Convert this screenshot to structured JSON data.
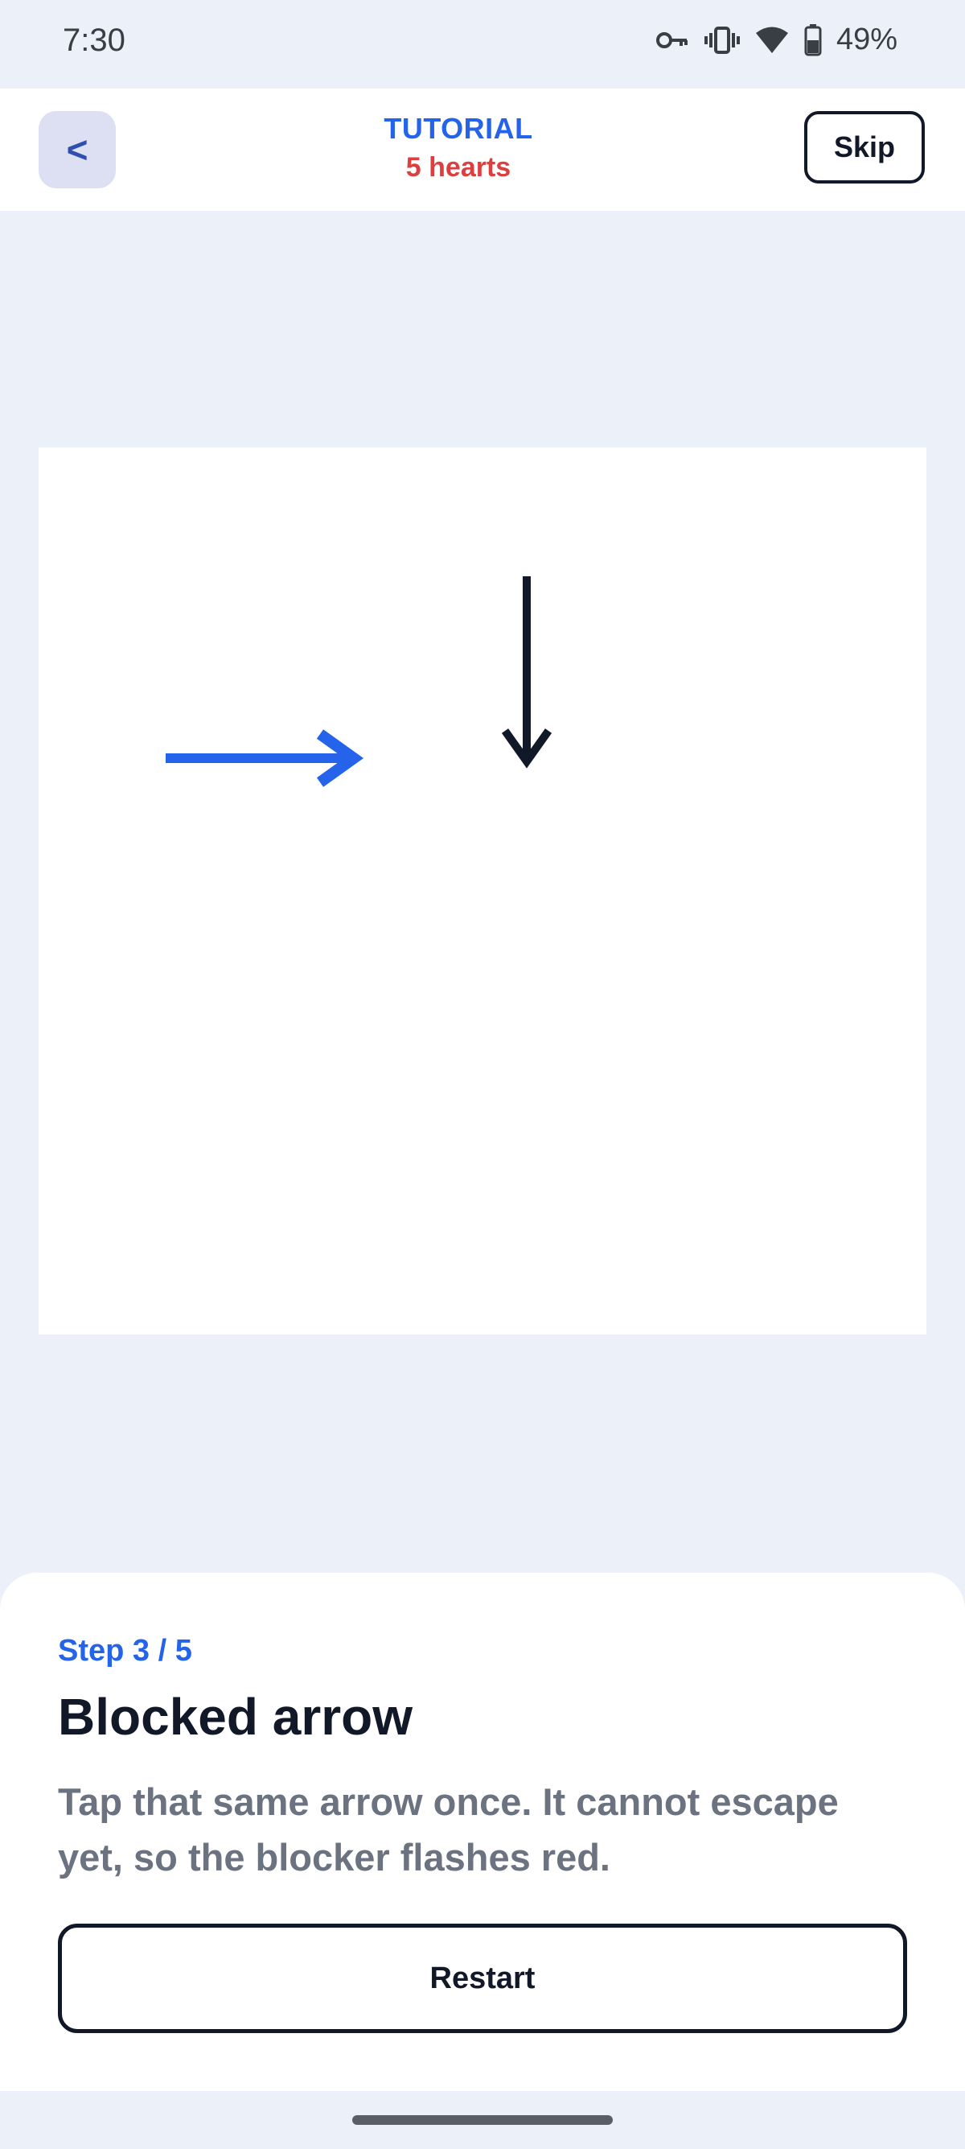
{
  "status_bar": {
    "time": "7:30",
    "battery": "49%",
    "icons": [
      "vpn-key-icon",
      "vibrate-icon",
      "wifi-icon",
      "battery-icon"
    ]
  },
  "header": {
    "back_label": "<",
    "title": "TUTORIAL",
    "hearts": "5 hearts",
    "skip_label": "Skip"
  },
  "board": {
    "arrows": [
      {
        "name": "blue-right-arrow",
        "direction": "right",
        "color": "#2563EB"
      },
      {
        "name": "black-down-arrow",
        "direction": "down",
        "color": "#111827"
      }
    ]
  },
  "sheet": {
    "step": "Step 3 / 5",
    "title": "Blocked arrow",
    "description": "Tap that same arrow once. It cannot escape yet, so the blocker flashes red.",
    "restart_label": "Restart"
  },
  "colors": {
    "background": "#ECF0F8",
    "accent": "#2563EB",
    "hearts": "#DC3F3F",
    "text": "#111827",
    "muted": "#6B7280"
  }
}
